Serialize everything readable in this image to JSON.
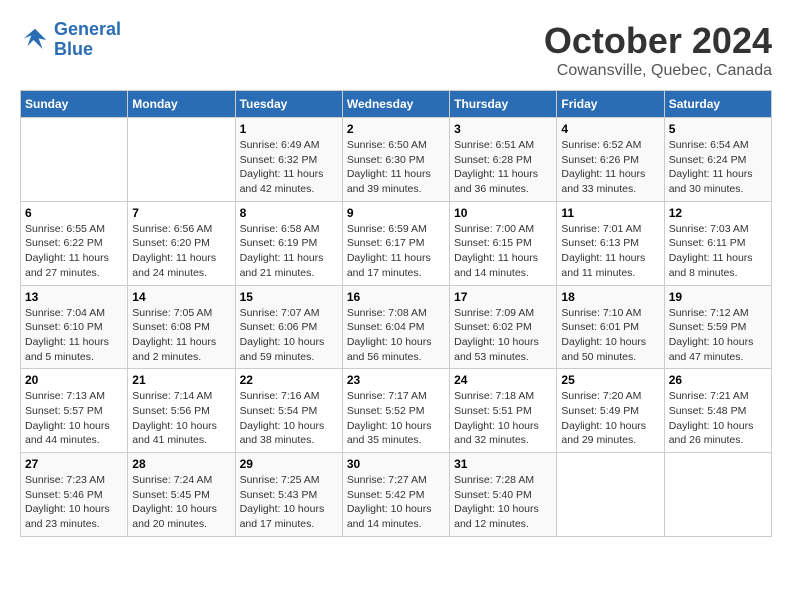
{
  "header": {
    "logo_line1": "General",
    "logo_line2": "Blue",
    "month_title": "October 2024",
    "subtitle": "Cowansville, Quebec, Canada"
  },
  "weekdays": [
    "Sunday",
    "Monday",
    "Tuesday",
    "Wednesday",
    "Thursday",
    "Friday",
    "Saturday"
  ],
  "weeks": [
    [
      {
        "day": "",
        "info": ""
      },
      {
        "day": "",
        "info": ""
      },
      {
        "day": "1",
        "info": "Sunrise: 6:49 AM\nSunset: 6:32 PM\nDaylight: 11 hours and 42 minutes."
      },
      {
        "day": "2",
        "info": "Sunrise: 6:50 AM\nSunset: 6:30 PM\nDaylight: 11 hours and 39 minutes."
      },
      {
        "day": "3",
        "info": "Sunrise: 6:51 AM\nSunset: 6:28 PM\nDaylight: 11 hours and 36 minutes."
      },
      {
        "day": "4",
        "info": "Sunrise: 6:52 AM\nSunset: 6:26 PM\nDaylight: 11 hours and 33 minutes."
      },
      {
        "day": "5",
        "info": "Sunrise: 6:54 AM\nSunset: 6:24 PM\nDaylight: 11 hours and 30 minutes."
      }
    ],
    [
      {
        "day": "6",
        "info": "Sunrise: 6:55 AM\nSunset: 6:22 PM\nDaylight: 11 hours and 27 minutes."
      },
      {
        "day": "7",
        "info": "Sunrise: 6:56 AM\nSunset: 6:20 PM\nDaylight: 11 hours and 24 minutes."
      },
      {
        "day": "8",
        "info": "Sunrise: 6:58 AM\nSunset: 6:19 PM\nDaylight: 11 hours and 21 minutes."
      },
      {
        "day": "9",
        "info": "Sunrise: 6:59 AM\nSunset: 6:17 PM\nDaylight: 11 hours and 17 minutes."
      },
      {
        "day": "10",
        "info": "Sunrise: 7:00 AM\nSunset: 6:15 PM\nDaylight: 11 hours and 14 minutes."
      },
      {
        "day": "11",
        "info": "Sunrise: 7:01 AM\nSunset: 6:13 PM\nDaylight: 11 hours and 11 minutes."
      },
      {
        "day": "12",
        "info": "Sunrise: 7:03 AM\nSunset: 6:11 PM\nDaylight: 11 hours and 8 minutes."
      }
    ],
    [
      {
        "day": "13",
        "info": "Sunrise: 7:04 AM\nSunset: 6:10 PM\nDaylight: 11 hours and 5 minutes."
      },
      {
        "day": "14",
        "info": "Sunrise: 7:05 AM\nSunset: 6:08 PM\nDaylight: 11 hours and 2 minutes."
      },
      {
        "day": "15",
        "info": "Sunrise: 7:07 AM\nSunset: 6:06 PM\nDaylight: 10 hours and 59 minutes."
      },
      {
        "day": "16",
        "info": "Sunrise: 7:08 AM\nSunset: 6:04 PM\nDaylight: 10 hours and 56 minutes."
      },
      {
        "day": "17",
        "info": "Sunrise: 7:09 AM\nSunset: 6:02 PM\nDaylight: 10 hours and 53 minutes."
      },
      {
        "day": "18",
        "info": "Sunrise: 7:10 AM\nSunset: 6:01 PM\nDaylight: 10 hours and 50 minutes."
      },
      {
        "day": "19",
        "info": "Sunrise: 7:12 AM\nSunset: 5:59 PM\nDaylight: 10 hours and 47 minutes."
      }
    ],
    [
      {
        "day": "20",
        "info": "Sunrise: 7:13 AM\nSunset: 5:57 PM\nDaylight: 10 hours and 44 minutes."
      },
      {
        "day": "21",
        "info": "Sunrise: 7:14 AM\nSunset: 5:56 PM\nDaylight: 10 hours and 41 minutes."
      },
      {
        "day": "22",
        "info": "Sunrise: 7:16 AM\nSunset: 5:54 PM\nDaylight: 10 hours and 38 minutes."
      },
      {
        "day": "23",
        "info": "Sunrise: 7:17 AM\nSunset: 5:52 PM\nDaylight: 10 hours and 35 minutes."
      },
      {
        "day": "24",
        "info": "Sunrise: 7:18 AM\nSunset: 5:51 PM\nDaylight: 10 hours and 32 minutes."
      },
      {
        "day": "25",
        "info": "Sunrise: 7:20 AM\nSunset: 5:49 PM\nDaylight: 10 hours and 29 minutes."
      },
      {
        "day": "26",
        "info": "Sunrise: 7:21 AM\nSunset: 5:48 PM\nDaylight: 10 hours and 26 minutes."
      }
    ],
    [
      {
        "day": "27",
        "info": "Sunrise: 7:23 AM\nSunset: 5:46 PM\nDaylight: 10 hours and 23 minutes."
      },
      {
        "day": "28",
        "info": "Sunrise: 7:24 AM\nSunset: 5:45 PM\nDaylight: 10 hours and 20 minutes."
      },
      {
        "day": "29",
        "info": "Sunrise: 7:25 AM\nSunset: 5:43 PM\nDaylight: 10 hours and 17 minutes."
      },
      {
        "day": "30",
        "info": "Sunrise: 7:27 AM\nSunset: 5:42 PM\nDaylight: 10 hours and 14 minutes."
      },
      {
        "day": "31",
        "info": "Sunrise: 7:28 AM\nSunset: 5:40 PM\nDaylight: 10 hours and 12 minutes."
      },
      {
        "day": "",
        "info": ""
      },
      {
        "day": "",
        "info": ""
      }
    ]
  ]
}
